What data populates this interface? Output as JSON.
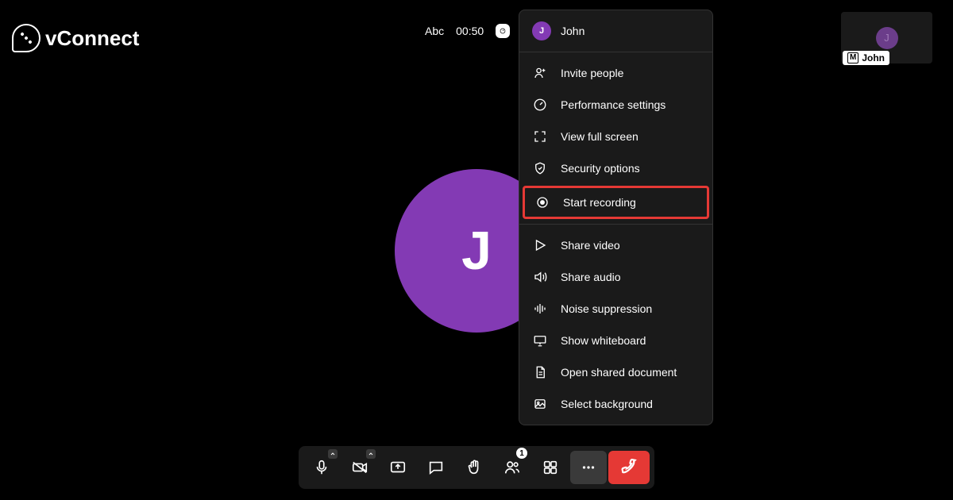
{
  "brand": {
    "name": "vConnect"
  },
  "top": {
    "mode_label": "Abc",
    "timer": "00:50"
  },
  "participant": {
    "name": "John",
    "initial": "J",
    "mute_badge": "M"
  },
  "main_avatar": {
    "initial": "J"
  },
  "menu": {
    "user": {
      "name": "John",
      "initial": "J"
    },
    "items": [
      {
        "label": "Invite people"
      },
      {
        "label": "Performance settings"
      },
      {
        "label": "View full screen"
      },
      {
        "label": "Security options"
      },
      {
        "label": "Start recording"
      },
      {
        "label": "Share video"
      },
      {
        "label": "Share audio"
      },
      {
        "label": "Noise suppression"
      },
      {
        "label": "Show whiteboard"
      },
      {
        "label": "Open shared document"
      },
      {
        "label": "Select background"
      }
    ]
  },
  "toolbar": {
    "participants_badge": "1"
  }
}
